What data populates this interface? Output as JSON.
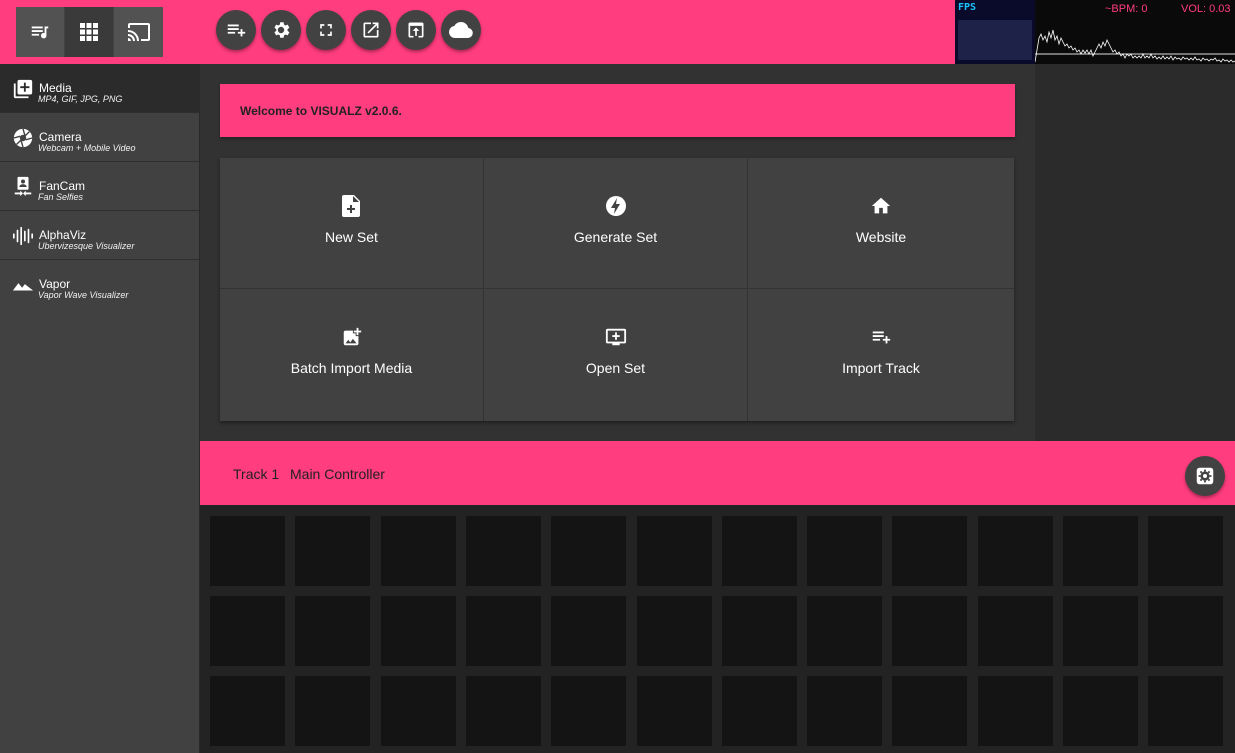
{
  "topbar": {
    "mode_buttons": [
      "playlist-icon",
      "grid-icon",
      "cast-icon"
    ],
    "tool_buttons": [
      "add-to-queue-icon",
      "settings-icon",
      "fullscreen-icon",
      "open-external-icon",
      "upload-icon",
      "cloud-icon"
    ]
  },
  "stats": {
    "fps_label": "FPS",
    "bpm": "~BPM: 0",
    "volume": "VOL: 0.03"
  },
  "sidebar": {
    "items": [
      {
        "title": "Media",
        "subtitle": "MP4, GIF, JPG, PNG",
        "icon": "add-media-icon"
      },
      {
        "title": "Camera",
        "subtitle": "Webcam + Mobile Video",
        "icon": "camera-iris-icon"
      },
      {
        "title": "FanCam",
        "subtitle": "Fan Selfies",
        "icon": "fancam-icon"
      },
      {
        "title": "AlphaViz",
        "subtitle": "Ubervizesque Visualizer",
        "icon": "waveform-icon"
      },
      {
        "title": "Vapor",
        "subtitle": "Vapor Wave Visualizer",
        "icon": "mountains-icon"
      }
    ]
  },
  "welcome": {
    "message": "Welcome to VISUALZ v2.0.6."
  },
  "actions": [
    {
      "label": "New Set",
      "icon": "new-file-icon"
    },
    {
      "label": "Generate Set",
      "icon": "bolt-icon"
    },
    {
      "label": "Website",
      "icon": "home-icon"
    },
    {
      "label": "Batch Import Media",
      "icon": "add-photo-icon"
    },
    {
      "label": "Open Set",
      "icon": "add-screen-icon"
    },
    {
      "label": "Import Track",
      "icon": "playlist-add-icon"
    }
  ],
  "track": {
    "name": "Track 1",
    "controller": "Main Controller",
    "settings_icon": "settings-icon"
  },
  "colors": {
    "accent": "#ff3d7f",
    "panel": "#414141",
    "background": "#2d2d2d"
  }
}
